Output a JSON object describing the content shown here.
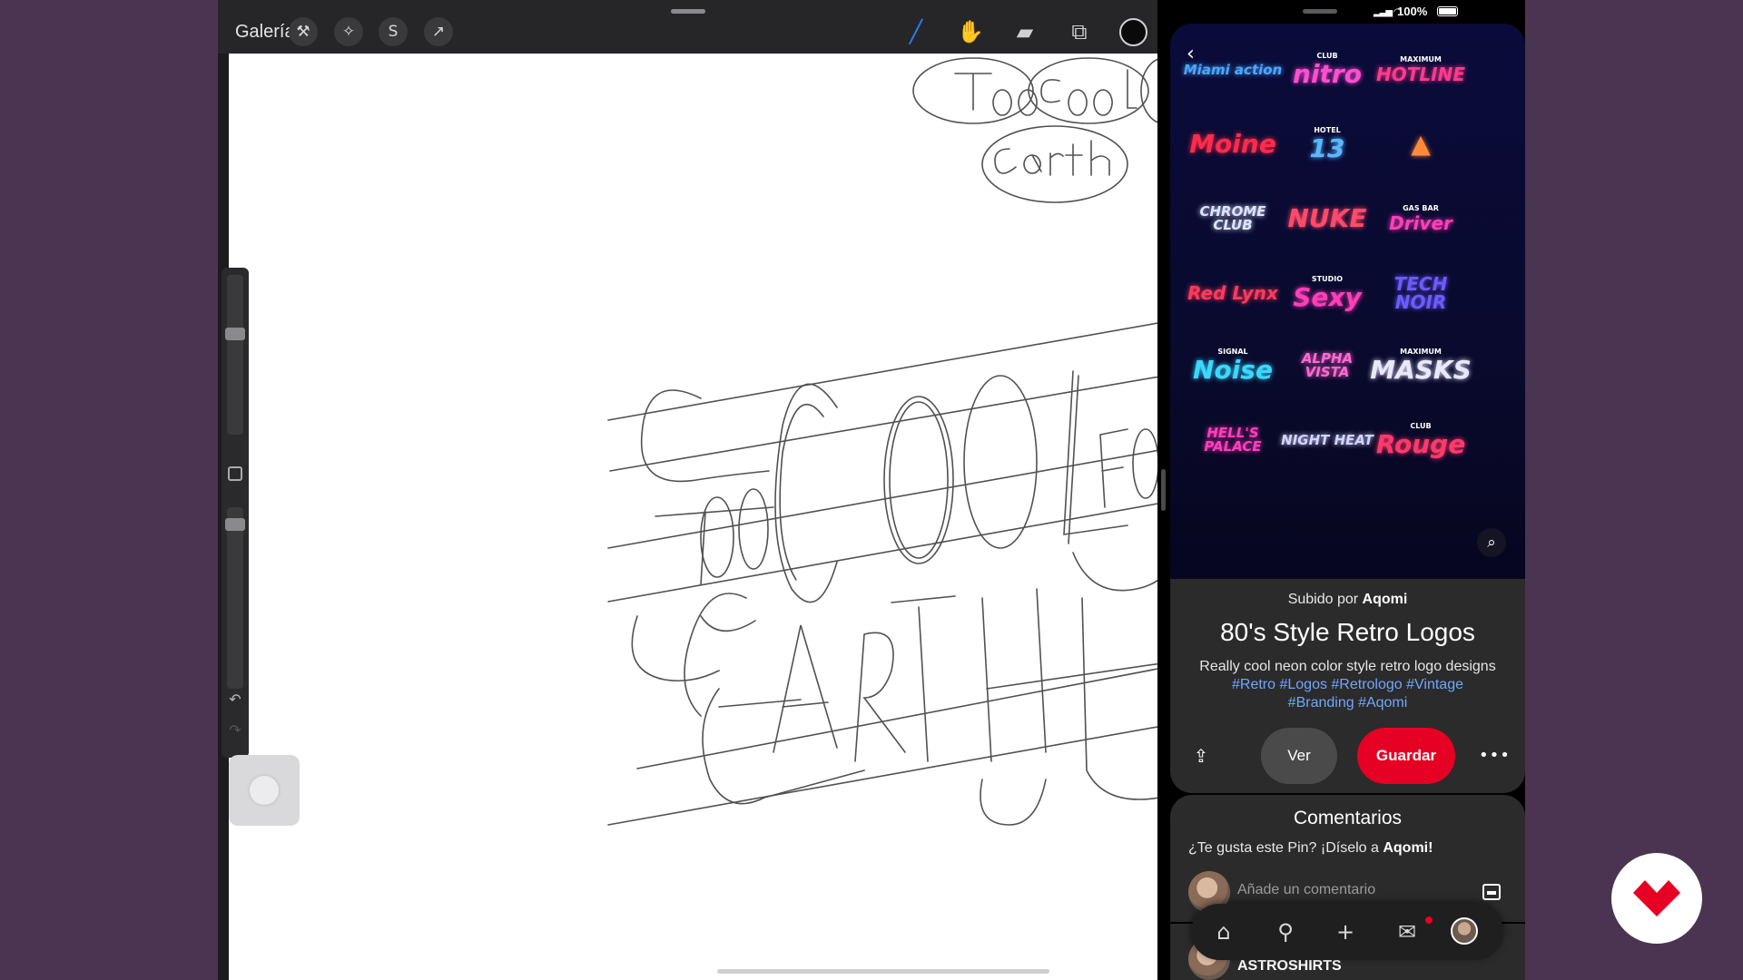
{
  "procreate": {
    "gallery_label": "Galería",
    "tools_left": [
      {
        "name": "wrench-icon",
        "glyph": "⚒"
      },
      {
        "name": "magic-wand-icon",
        "glyph": "✧"
      },
      {
        "name": "selection-icon",
        "glyph": "S"
      },
      {
        "name": "transform-arrow-icon",
        "glyph": "↗"
      }
    ],
    "tools_right": [
      {
        "name": "brush-icon",
        "glyph": "╱",
        "color": "#2f7bff"
      },
      {
        "name": "smudge-icon",
        "glyph": "✋",
        "color": "#d0d0d3"
      },
      {
        "name": "eraser-icon",
        "glyph": "▰",
        "color": "#d0d0d3"
      },
      {
        "name": "layers-icon",
        "glyph": "⧉",
        "color": "#d0d0d3"
      }
    ],
    "active_color": "#0a0a0a",
    "undo_glyph": "↶",
    "redo_glyph": "↷"
  },
  "status": {
    "battery": "100%"
  },
  "pin": {
    "logos": [
      {
        "text": "Miami action",
        "color": "#4aa8ff"
      },
      {
        "text": "nitro",
        "color": "#ff4fd2",
        "sub": "CLUB"
      },
      {
        "text": "HOTLINE",
        "color": "#ff3a8c",
        "sub": "MAXIMUM"
      },
      {
        "text": "Moine",
        "color": "#ff2b4a"
      },
      {
        "text": "13",
        "color": "#5ab8ff",
        "sub": "HOTEL"
      },
      {
        "text": "▲",
        "color": "#ff8a3a"
      },
      {
        "text": "CHROME CLUB",
        "color": "#d9e6ff"
      },
      {
        "text": "NUKE",
        "color": "#ff4a6a"
      },
      {
        "text": "Driver",
        "color": "#ff3fb8",
        "sub": "GAS BAR"
      },
      {
        "text": "Red Lynx",
        "color": "#ff3a5a"
      },
      {
        "text": "Sexy",
        "color": "#ff3fb8",
        "sub": "STUDIO"
      },
      {
        "text": "TECH NOIR",
        "color": "#6a5cff"
      },
      {
        "text": "Noise",
        "color": "#3ad8ff",
        "sub": "SIGNAL"
      },
      {
        "text": "ALPHA VISTA",
        "color": "#ff6ad0"
      },
      {
        "text": "MASKS",
        "color": "#e8e8ff",
        "sub": "MAXIMUM"
      },
      {
        "text": "HELL'S PALACE",
        "color": "#ff3fb8"
      },
      {
        "text": "NIGHT HEAT",
        "color": "#d0d6ff"
      },
      {
        "text": "Rouge",
        "color": "#ff3a6a",
        "sub": "CLUB"
      }
    ],
    "uploaded_prefix": "Subido por",
    "uploader": "Aqomi",
    "title": "80's Style Retro Logos",
    "description": "Really cool neon color style retro logo designs",
    "tags": "#Retro #Logos #Retrologo #Vintage #Branding #Aqomi",
    "view_label": "Ver",
    "save_label": "Guardar",
    "more_glyph": "•••"
  },
  "comments": {
    "title": "Comentarios",
    "prompt_text": "¿Te gusta este Pin? ¡Díselo a",
    "prompt_user": "Aqomi!",
    "placeholder": "Añade un comentario"
  },
  "next_pin": {
    "name": "ASTROSHIRTS"
  },
  "tabs": [
    {
      "name": "home-tab-icon",
      "glyph": "⌂"
    },
    {
      "name": "search-tab-icon",
      "glyph": "⚲"
    },
    {
      "name": "create-tab-icon",
      "glyph": "+"
    },
    {
      "name": "messages-tab-icon",
      "glyph": "✉"
    }
  ],
  "brand_color": "#e60023"
}
